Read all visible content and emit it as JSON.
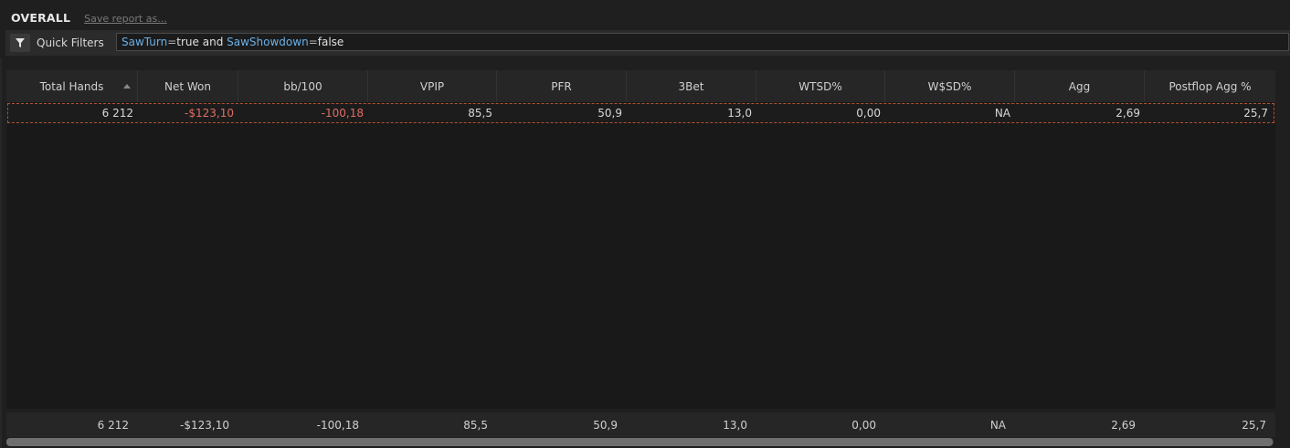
{
  "header": {
    "title": "OVERALL",
    "save_link": "Save report as..."
  },
  "filter": {
    "label": "Quick Filters",
    "icon": "funnel-icon",
    "query": {
      "key1": "SawTurn",
      "op1": "=",
      "val1": "true and ",
      "key2": "SawShowdown",
      "op2": "=",
      "val2": "false"
    }
  },
  "columns": [
    "Total Hands",
    "Net Won",
    "bb/100",
    "VPIP",
    "PFR",
    "3Bet",
    "WTSD%",
    "W$SD%",
    "Agg",
    "Postflop Agg %"
  ],
  "rows": [
    [
      "6 212",
      "-$123,10",
      "-100,18",
      "85,5",
      "50,9",
      "13,0",
      "0,00",
      "NA",
      "2,69",
      "25,7"
    ]
  ],
  "totals": [
    "6 212",
    "-$123,10",
    "-100,18",
    "85,5",
    "50,9",
    "13,0",
    "0,00",
    "NA",
    "2,69",
    "25,7"
  ],
  "colors": {
    "negative": "#e06e62",
    "selected_row_border": "#b2542e",
    "filter_key": "#6ab0e8"
  }
}
